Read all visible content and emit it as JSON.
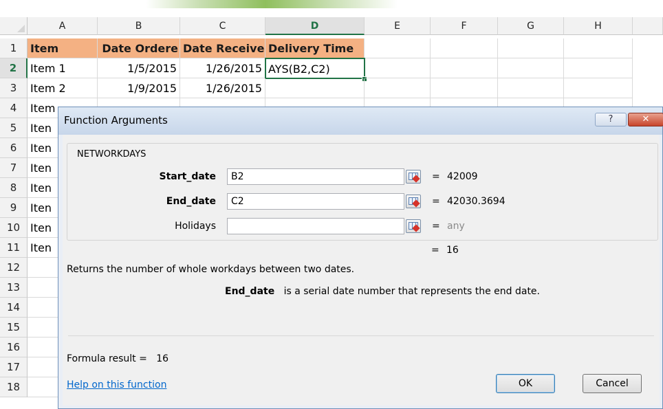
{
  "columns": [
    "A",
    "B",
    "C",
    "D",
    "E",
    "F",
    "G",
    "H"
  ],
  "selected_column": "D",
  "rows": [
    "1",
    "2",
    "3",
    "4",
    "5",
    "6",
    "7",
    "8",
    "9",
    "10",
    "11",
    "12",
    "13",
    "14",
    "15",
    "16",
    "17",
    "18"
  ],
  "selected_row": "2",
  "header_row": [
    "Item",
    "Date Ordere",
    "Date Receive",
    "Delivery Time"
  ],
  "data_rows": [
    [
      "Item 1",
      "1/5/2015",
      "1/26/2015",
      "AYS(B2,C2)"
    ],
    [
      "Item 2",
      "1/9/2015",
      "1/26/2015",
      ""
    ]
  ],
  "partial_items": [
    "Item",
    "Iten",
    "Iten",
    "Iten",
    "Iten",
    "Iten",
    "Iten",
    "Iten"
  ],
  "colors": {
    "header_fill": "#f4b183",
    "accent": "#217346",
    "link": "#0066cc"
  },
  "dialog": {
    "title": "Function Arguments",
    "help_label": "?",
    "close_label": "✕",
    "function_name": "NETWORKDAYS",
    "args": [
      {
        "label": "Start_date",
        "value": "B2",
        "result": "42009",
        "bold": true
      },
      {
        "label": "End_date",
        "value": "C2",
        "result": "42030.3694",
        "bold": true
      },
      {
        "label": "Holidays",
        "value": "",
        "result": "any",
        "bold": false
      }
    ],
    "equals": "=",
    "overall_result": "16",
    "description": "Returns the number of whole workdays between two dates.",
    "arg_name": "End_date",
    "arg_description": "is a serial date number that represents the end date.",
    "formula_result_label": "Formula result =",
    "formula_result_value": "16",
    "help_link": "Help on this function",
    "ok_label": "OK",
    "cancel_label": "Cancel",
    "ref_icon": "range-select-icon"
  }
}
